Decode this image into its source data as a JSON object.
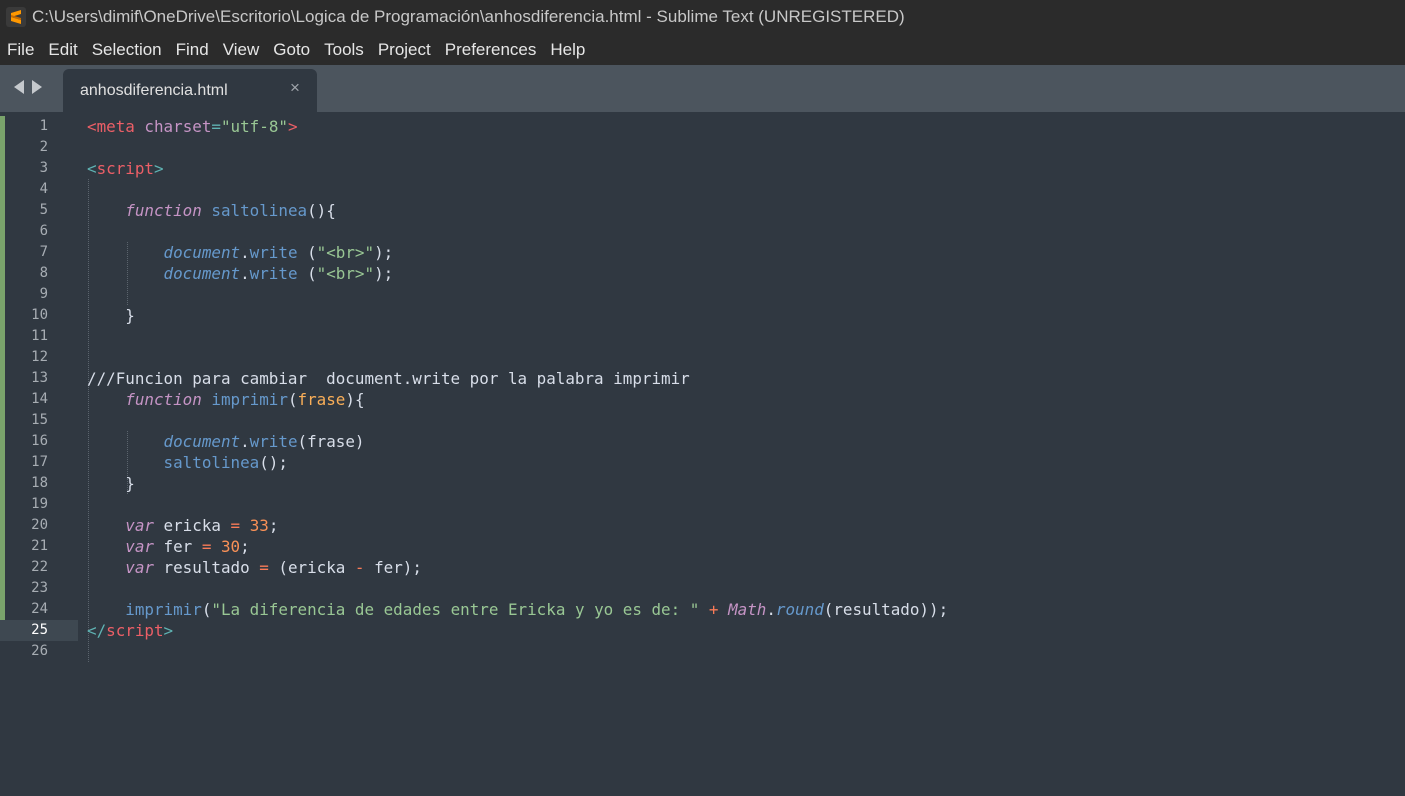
{
  "window": {
    "title": "C:\\Users\\dimif\\OneDrive\\Escritorio\\Logica de Programación\\anhosdiferencia.html - Sublime Text (UNREGISTERED)",
    "app_icon": "sublime-text-icon"
  },
  "menu": [
    "File",
    "Edit",
    "Selection",
    "Find",
    "View",
    "Goto",
    "Tools",
    "Project",
    "Preferences",
    "Help"
  ],
  "tab": {
    "label": "anhosdiferencia.html",
    "close_label": "×"
  },
  "editor": {
    "current_line": 25,
    "line_numbers": [
      "1",
      "2",
      "3",
      "4",
      "5",
      "6",
      "7",
      "8",
      "9",
      "10",
      "11",
      "12",
      "13",
      "14",
      "15",
      "16",
      "17",
      "18",
      "19",
      "20",
      "21",
      "22",
      "23",
      "24",
      "25",
      "26"
    ],
    "lines": [
      [
        [
          "tag",
          "<meta"
        ],
        [
          "plain",
          " "
        ],
        [
          "attr",
          "charset"
        ],
        [
          "punct",
          "="
        ],
        [
          "str",
          "\"utf-8\""
        ],
        [
          "tag",
          ">"
        ]
      ],
      [],
      [
        [
          "punct",
          "<"
        ],
        [
          "tag",
          "script"
        ],
        [
          "punct",
          ">"
        ]
      ],
      [],
      [
        [
          "plain",
          "    "
        ],
        [
          "kw",
          "function"
        ],
        [
          "plain",
          " "
        ],
        [
          "fn",
          "saltolinea"
        ],
        [
          "plain",
          "(){"
        ]
      ],
      [],
      [
        [
          "plain",
          "        "
        ],
        [
          "obj",
          "document"
        ],
        [
          "plain",
          "."
        ],
        [
          "fn",
          "write"
        ],
        [
          "plain",
          " ("
        ],
        [
          "str",
          "\"<br>\""
        ],
        [
          "plain",
          ");"
        ]
      ],
      [
        [
          "plain",
          "        "
        ],
        [
          "obj",
          "document"
        ],
        [
          "plain",
          "."
        ],
        [
          "fn",
          "write"
        ],
        [
          "plain",
          " ("
        ],
        [
          "str",
          "\"<br>\""
        ],
        [
          "plain",
          ");"
        ]
      ],
      [],
      [
        [
          "plain",
          "    }"
        ]
      ],
      [],
      [],
      [
        [
          "cmt",
          "///Funcion para cambiar  document.write por la palabra imprimir"
        ]
      ],
      [
        [
          "plain",
          "    "
        ],
        [
          "kw",
          "function"
        ],
        [
          "plain",
          " "
        ],
        [
          "fn",
          "imprimir"
        ],
        [
          "plain",
          "("
        ],
        [
          "param",
          "frase"
        ],
        [
          "plain",
          "){"
        ]
      ],
      [],
      [
        [
          "plain",
          "        "
        ],
        [
          "obj",
          "document"
        ],
        [
          "plain",
          "."
        ],
        [
          "fn",
          "write"
        ],
        [
          "plain",
          "(frase)"
        ]
      ],
      [
        [
          "plain",
          "        "
        ],
        [
          "fn",
          "saltolinea"
        ],
        [
          "plain",
          "();"
        ]
      ],
      [
        [
          "plain",
          "    }"
        ]
      ],
      [],
      [
        [
          "plain",
          "    "
        ],
        [
          "kw",
          "var"
        ],
        [
          "plain",
          " ericka "
        ],
        [
          "op",
          "="
        ],
        [
          "plain",
          " "
        ],
        [
          "num",
          "33"
        ],
        [
          "plain",
          ";"
        ]
      ],
      [
        [
          "plain",
          "    "
        ],
        [
          "kw",
          "var"
        ],
        [
          "plain",
          " fer "
        ],
        [
          "op",
          "="
        ],
        [
          "plain",
          " "
        ],
        [
          "num",
          "30"
        ],
        [
          "plain",
          ";"
        ]
      ],
      [
        [
          "plain",
          "    "
        ],
        [
          "kw",
          "var"
        ],
        [
          "plain",
          " resultado "
        ],
        [
          "op",
          "="
        ],
        [
          "plain",
          " (ericka "
        ],
        [
          "op",
          "-"
        ],
        [
          "plain",
          " fer);"
        ]
      ],
      [],
      [
        [
          "plain",
          "    "
        ],
        [
          "fn",
          "imprimir"
        ],
        [
          "plain",
          "("
        ],
        [
          "str",
          "\"La diferencia de edades entre Ericka y yo es de: \""
        ],
        [
          "plain",
          " "
        ],
        [
          "op",
          "+"
        ],
        [
          "plain",
          " "
        ],
        [
          "mathobj",
          "Math"
        ],
        [
          "plain",
          "."
        ],
        [
          "roundfn",
          "round"
        ],
        [
          "plain",
          "(resultado));"
        ]
      ],
      [
        [
          "punct",
          "</"
        ],
        [
          "tag",
          "script"
        ],
        [
          "punct",
          ">"
        ]
      ],
      []
    ]
  }
}
